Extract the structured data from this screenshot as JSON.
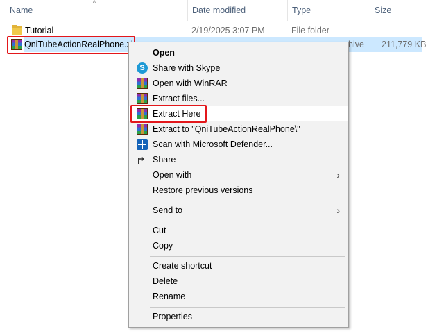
{
  "columns": {
    "name": "Name",
    "date_modified": "Date modified",
    "type": "Type",
    "size": "Size"
  },
  "rows": [
    {
      "name": "Tutorial",
      "date": "2/19/2025 3:07 PM",
      "type": "File folder",
      "size": "",
      "icon": "folder-icon"
    },
    {
      "name": "QniTubeActionRealPhone.zip",
      "name_shown": "QniTubeActionRealPhone.zi",
      "date": "",
      "type_partial": "hive",
      "size": "211,779 KB",
      "icon": "winrar-icon"
    }
  ],
  "context_menu": {
    "items": [
      {
        "label": "Open",
        "icon": "",
        "bold": true
      },
      {
        "label": "Share with Skype",
        "icon": "skype-icon"
      },
      {
        "label": "Open with WinRAR",
        "icon": "winrar-icon"
      },
      {
        "label": "Extract files...",
        "icon": "winrar-icon"
      },
      {
        "label": "Extract Here",
        "icon": "winrar-icon",
        "highlighted": true
      },
      {
        "label": "Extract to \"QniTubeActionRealPhone\\\"",
        "icon": "winrar-icon"
      },
      {
        "label": "Scan with Microsoft Defender...",
        "icon": "defender-icon"
      },
      {
        "label": "Share",
        "icon": "share-icon"
      },
      {
        "label": "Open with",
        "icon": "",
        "submenu": true
      },
      {
        "label": "Restore previous versions",
        "icon": ""
      },
      {
        "label": "Send to",
        "icon": "",
        "submenu": true
      },
      {
        "label": "Cut",
        "icon": ""
      },
      {
        "label": "Copy",
        "icon": ""
      },
      {
        "label": "Create shortcut",
        "icon": ""
      },
      {
        "label": "Delete",
        "icon": ""
      },
      {
        "label": "Rename",
        "icon": ""
      },
      {
        "label": "Properties",
        "icon": ""
      }
    ]
  },
  "colors": {
    "selection": "#cce8ff",
    "annotation": "#e3171b",
    "header_text": "#4c607a"
  }
}
